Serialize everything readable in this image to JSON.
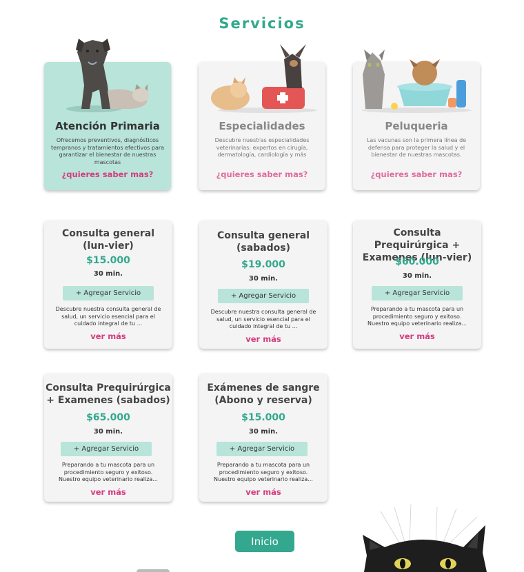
{
  "theme": {
    "teal": "#33a88e",
    "pink": "#d43a7f"
  },
  "section_title": "Servicios",
  "categories": [
    {
      "title": "Atención Primaria",
      "description": "Ofrecemos preventivos, diagnósticos tempranos y tratamientos efectivos para garantizar el bienestar de nuestras mascotas",
      "link": "¿quieres saber mas?",
      "active": true,
      "icon": "great-dane-and-cat-image"
    },
    {
      "title": "Especialidades",
      "description": "Descubre nuestras especialidades veterinarias: expertos en cirugía, dermatología, cardiología y más",
      "link": "¿quieres saber mas?",
      "active": false,
      "icon": "dogs-with-first-aid-kit-image"
    },
    {
      "title": "Peluqueria",
      "description": "Las vacunas son la primera línea de defensa para proteger la salud y el bienestar de nuestras mascotas.",
      "link": "¿quieres saber mas?",
      "active": false,
      "icon": "cat-and-dog-bath-tub-image"
    }
  ],
  "services": [
    {
      "name": "Consulta general (lun-vier)",
      "price": "$15.000",
      "duration": "30 min.",
      "add_label": "+ Agregar Servicio",
      "description": "Descubre nuestra consulta general de salud, un servicio esencial para el cuidado integral de tu ...",
      "more": "ver más"
    },
    {
      "name": "Consulta general (sabados)",
      "price": "$19.000",
      "duration": "30 min.",
      "add_label": "+ Agregar Servicio",
      "description": "Descubre nuestra consulta general de salud, un servicio esencial para el cuidado integral de tu ...",
      "more": "ver más"
    },
    {
      "name": "Consulta Prequirúrgica + Examenes (lun-vier)",
      "price": "$60.000",
      "duration": "30 min.",
      "add_label": "+ Agregar Servicio",
      "description": "Preparando a tu mascota para un procedimiento seguro y exitoso. Nuestro equipo veterinario realiza...",
      "more": "ver más"
    },
    {
      "name": "Consulta Prequirúrgica + Examenes (sabados)",
      "price": "$65.000",
      "duration": "30 min.",
      "add_label": "+ Agregar Servicio",
      "description": "Preparando a tu mascota para un procedimiento seguro y exitoso. Nuestro equipo veterinario realiza...",
      "more": "ver más"
    },
    {
      "name": "Exámenes de sangre (Abono y reserva)",
      "price": "$15.000",
      "duration": "30 min.",
      "add_label": "+ Agregar Servicio",
      "description": "Preparando a tu mascota para un procedimiento seguro y exitoso. Nuestro equipo veterinario realiza...",
      "more": "ver más"
    }
  ],
  "home_button": "Inicio",
  "decor": {
    "bottom_image": "black-cat-peeking-image"
  }
}
